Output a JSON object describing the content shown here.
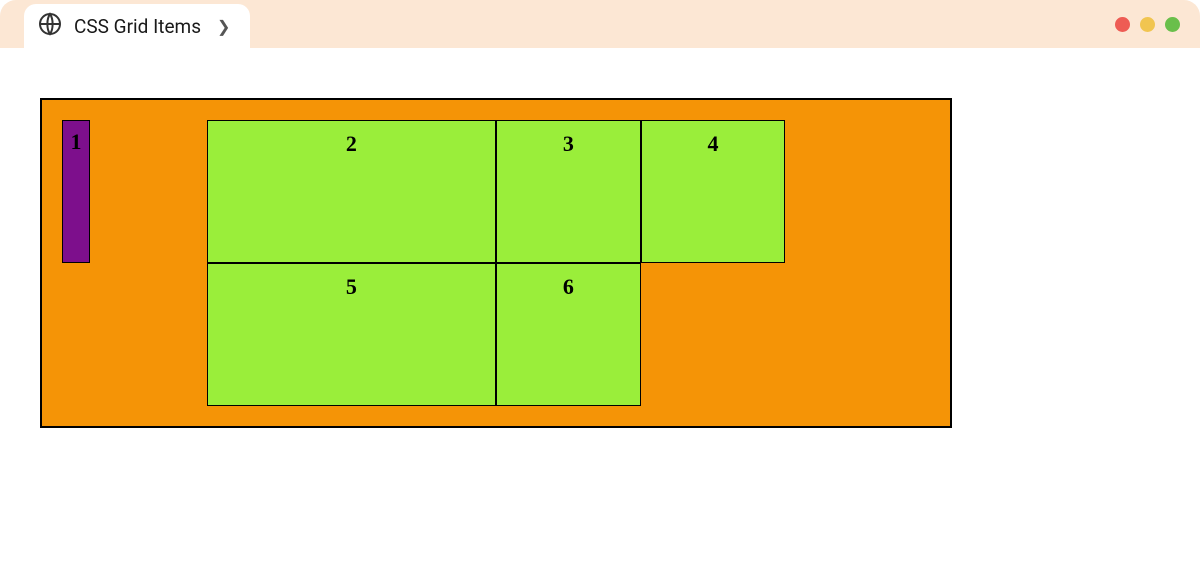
{
  "tab": {
    "title": "CSS Grid Items"
  },
  "grid": {
    "items": [
      {
        "label": "1"
      },
      {
        "label": "2"
      },
      {
        "label": "3"
      },
      {
        "label": "4"
      },
      {
        "label": "5"
      },
      {
        "label": "6"
      }
    ]
  }
}
